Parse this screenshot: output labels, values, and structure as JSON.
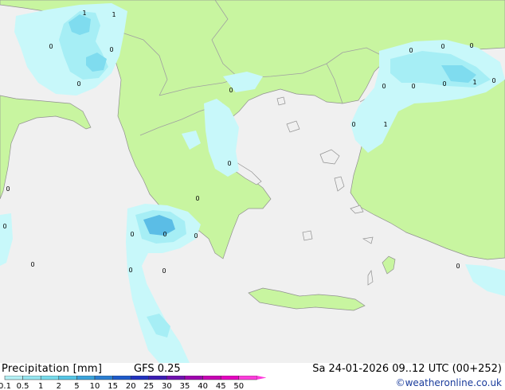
{
  "header": {
    "product_label": "Precipitation [mm]",
    "model_label": "GFS 0.25",
    "valid_time": "Sa 24-01-2026 09..12 UTC (00+252)"
  },
  "credit": {
    "text": "©weatheronline.co.uk"
  },
  "legend": {
    "unit": "mm",
    "ticks": [
      "0.1",
      "0.5",
      "1",
      "2",
      "5",
      "10",
      "15",
      "20",
      "25",
      "30",
      "35",
      "40",
      "45",
      "50"
    ],
    "colors": [
      "#b4f0f4",
      "#96e6f0",
      "#78dcec",
      "#55c6e6",
      "#3ba4dc",
      "#2a7fd2",
      "#1d5acb",
      "#2032c0",
      "#3a1cb4",
      "#7010b0",
      "#a000b0",
      "#c800b4",
      "#e600c0",
      "#ff3cdc"
    ]
  },
  "map": {
    "colors": {
      "sea": "#f0f0f0",
      "land": "#c8f5a0",
      "border": "#a0a0a0",
      "coast": "#909090",
      "precip_light": "#c8f8fa",
      "precip_mid": "#a6eef5",
      "precip_heavy": "#7fdcef",
      "precip_max": "#5bbde6"
    },
    "point_labels": [
      "1",
      "1",
      "0",
      "0",
      "0",
      "0",
      "0",
      "0",
      "0",
      "0",
      "0",
      "0",
      "1",
      "0",
      "0",
      "1",
      "0",
      "0",
      "0",
      "0",
      "0",
      "0",
      "0",
      "0",
      "0",
      "0",
      "0"
    ]
  }
}
